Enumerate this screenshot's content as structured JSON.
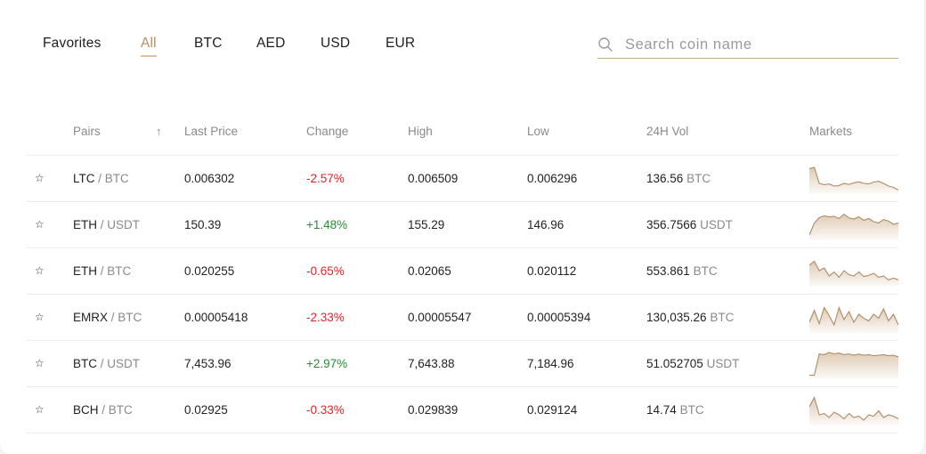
{
  "tabs": [
    {
      "label": "Favorites",
      "active": false
    },
    {
      "label": "All",
      "active": true
    },
    {
      "label": "BTC",
      "active": false
    },
    {
      "label": "AED",
      "active": false
    },
    {
      "label": "USD",
      "active": false
    },
    {
      "label": "EUR",
      "active": false
    }
  ],
  "search": {
    "placeholder": "Search coin name",
    "value": ""
  },
  "colors": {
    "accent": "#b68e5f",
    "negative": "#e0262a",
    "positive": "#2a8a35",
    "sparkline": "#c4a07a"
  },
  "table": {
    "headers": {
      "pairs": "Pairs",
      "sort_indicator": "↑",
      "last_price": "Last Price",
      "change": "Change",
      "high": "High",
      "low": "Low",
      "vol": "24H Vol",
      "markets": "Markets"
    },
    "rows": [
      {
        "base": "LTC",
        "sep": " / ",
        "quote": "BTC",
        "last": "0.006302",
        "change": "-2.57%",
        "direction": "down",
        "high": "0.006509",
        "low": "0.006296",
        "vol": "136.56",
        "vol_unit": "BTC",
        "spark": [
          0.85,
          0.9,
          0.3,
          0.25,
          0.28,
          0.2,
          0.22,
          0.3,
          0.26,
          0.32,
          0.36,
          0.3,
          0.28,
          0.35,
          0.38,
          0.3,
          0.2,
          0.15,
          0.05
        ]
      },
      {
        "base": "ETH",
        "sep": " / ",
        "quote": "USDT",
        "last": "150.39",
        "change": "+1.48%",
        "direction": "up",
        "high": "155.29",
        "low": "146.96",
        "vol": "356.7566",
        "vol_unit": "USDT",
        "spark": [
          0.1,
          0.55,
          0.75,
          0.82,
          0.78,
          0.8,
          0.72,
          0.88,
          0.74,
          0.7,
          0.78,
          0.65,
          0.72,
          0.6,
          0.55,
          0.68,
          0.62,
          0.5,
          0.55
        ]
      },
      {
        "base": "ETH",
        "sep": " / ",
        "quote": "BTC",
        "last": "0.020255",
        "change": "-0.65%",
        "direction": "down",
        "high": "0.02065",
        "low": "0.020112",
        "vol": "553.861",
        "vol_unit": "BTC",
        "spark": [
          0.7,
          0.85,
          0.5,
          0.6,
          0.3,
          0.45,
          0.25,
          0.5,
          0.35,
          0.3,
          0.45,
          0.28,
          0.32,
          0.4,
          0.25,
          0.3,
          0.15,
          0.22,
          0.15
        ]
      },
      {
        "base": "EMRX",
        "sep": " / ",
        "quote": "BTC",
        "last": "0.00005418",
        "change": "-2.33%",
        "direction": "down",
        "high": "0.00005547",
        "low": "0.00005394",
        "vol": "130,035.26",
        "vol_unit": "BTC",
        "spark": [
          0.3,
          0.75,
          0.25,
          0.85,
          0.55,
          0.2,
          0.85,
          0.4,
          0.7,
          0.3,
          0.6,
          0.45,
          0.35,
          0.6,
          0.45,
          0.8,
          0.35,
          0.6,
          0.2
        ]
      },
      {
        "base": "BTC",
        "sep": " / ",
        "quote": "USDT",
        "last": "7,453.96",
        "change": "+2.97%",
        "direction": "up",
        "high": "7,643.88",
        "low": "7,184.96",
        "vol": "51.052705",
        "vol_unit": "USDT",
        "spark": [
          0.05,
          0.05,
          0.85,
          0.82,
          0.9,
          0.85,
          0.88,
          0.82,
          0.85,
          0.8,
          0.84,
          0.8,
          0.82,
          0.78,
          0.8,
          0.82,
          0.78,
          0.8,
          0.74
        ]
      },
      {
        "base": "BCH",
        "sep": " / ",
        "quote": "BTC",
        "last": "0.02925",
        "change": "-0.33%",
        "direction": "down",
        "high": "0.029839",
        "low": "0.029124",
        "vol": "14.74",
        "vol_unit": "BTC",
        "spark": [
          0.6,
          0.95,
          0.3,
          0.35,
          0.2,
          0.4,
          0.3,
          0.15,
          0.35,
          0.2,
          0.25,
          0.1,
          0.3,
          0.25,
          0.45,
          0.2,
          0.3,
          0.25,
          0.15
        ]
      }
    ]
  }
}
